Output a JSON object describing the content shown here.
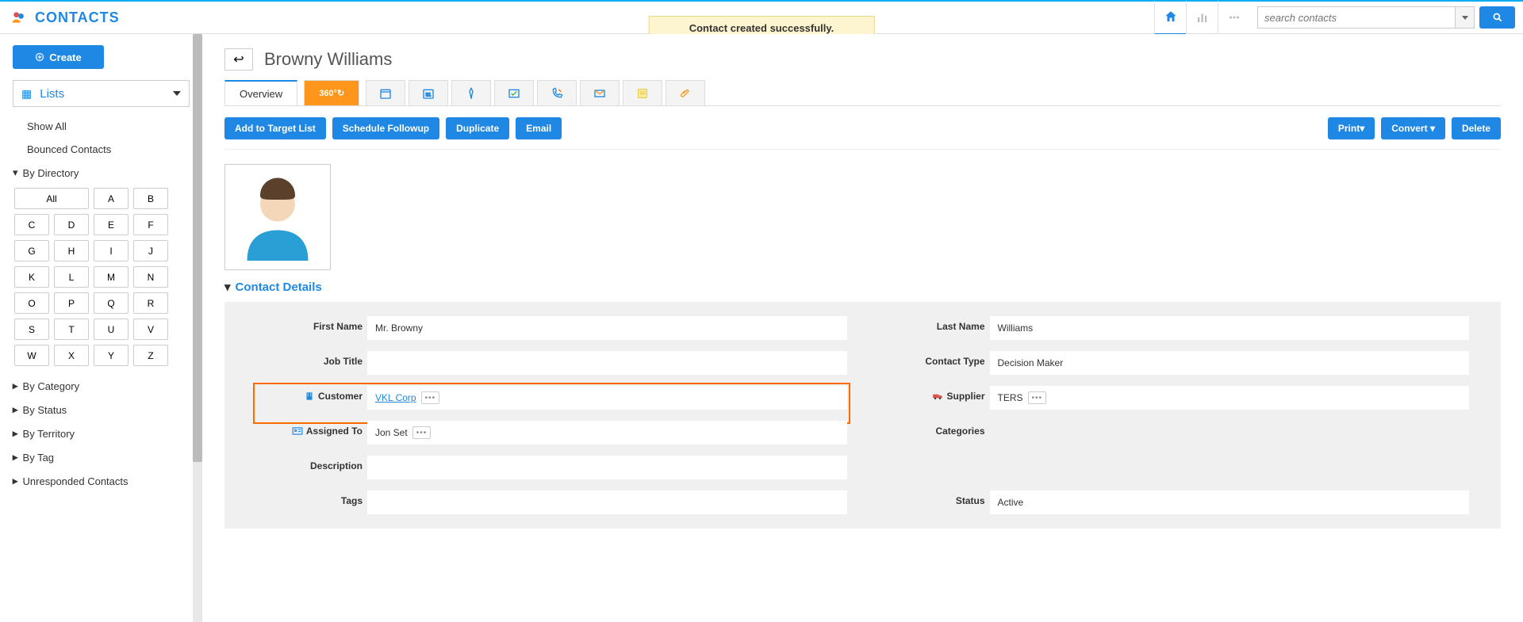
{
  "app": {
    "title": "CONTACTS"
  },
  "alert": {
    "message": "Contact created successfully."
  },
  "search": {
    "placeholder": "search contacts"
  },
  "sidebar": {
    "create": "Create",
    "lists_label": "Lists",
    "show_all": "Show All",
    "bounced": "Bounced Contacts",
    "by_directory": "By Directory",
    "dir_all": "All",
    "dir_letters": [
      "A",
      "B",
      "C",
      "D",
      "E",
      "F",
      "G",
      "H",
      "I",
      "J",
      "K",
      "L",
      "M",
      "N",
      "O",
      "P",
      "Q",
      "R",
      "S",
      "T",
      "U",
      "V",
      "W",
      "X",
      "Y",
      "Z"
    ],
    "by_category": "By Category",
    "by_status": "By Status",
    "by_territory": "By Territory",
    "by_tag": "By Tag",
    "unresponded": "Unresponded Contacts"
  },
  "page": {
    "title": "Browny Williams"
  },
  "tabs": {
    "overview": "Overview",
    "t360": "360°"
  },
  "actions": {
    "add_target": "Add to Target List",
    "schedule": "Schedule Followup",
    "duplicate": "Duplicate",
    "email": "Email",
    "print": "Print",
    "convert": "Convert",
    "delete": "Delete"
  },
  "section": {
    "contact_details": "Contact Details"
  },
  "fields": {
    "first_name": {
      "label": "First Name",
      "value": "Mr. Browny"
    },
    "last_name": {
      "label": "Last Name",
      "value": "Williams"
    },
    "job_title": {
      "label": "Job Title",
      "value": ""
    },
    "contact_type": {
      "label": "Contact Type",
      "value": "Decision Maker"
    },
    "customer": {
      "label": "Customer",
      "value": "VKL Corp"
    },
    "supplier": {
      "label": "Supplier",
      "value": "TERS"
    },
    "assigned_to": {
      "label": "Assigned To",
      "value": "Jon Set"
    },
    "categories": {
      "label": "Categories",
      "value": ""
    },
    "description": {
      "label": "Description",
      "value": ""
    },
    "tags": {
      "label": "Tags",
      "value": ""
    },
    "status": {
      "label": "Status",
      "value": "Active"
    }
  }
}
